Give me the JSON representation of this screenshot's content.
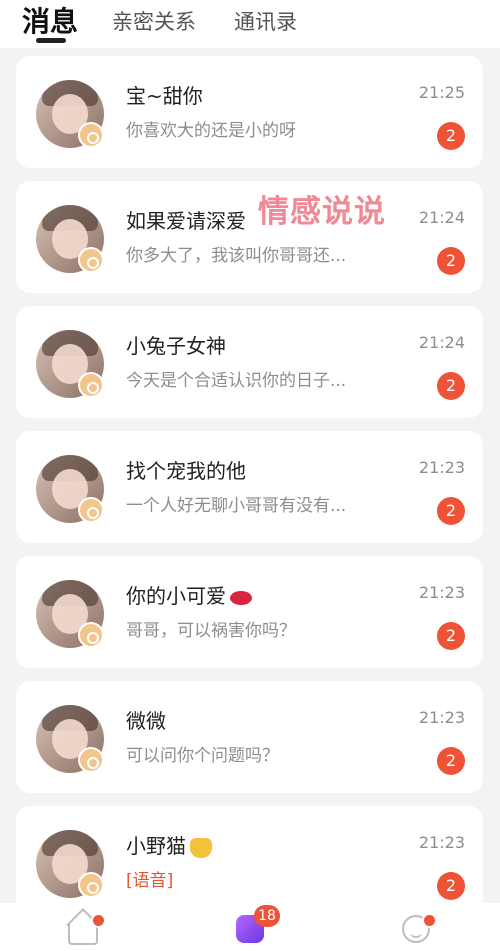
{
  "header": {
    "tabs": [
      {
        "label": "消息"
      },
      {
        "label": "亲密关系"
      },
      {
        "label": "通讯录"
      }
    ]
  },
  "watermark": "情感说说",
  "conversations": [
    {
      "name": "宝~甜你",
      "preview": "你喜欢大的还是小的呀",
      "time": "21:25",
      "unread": "2"
    },
    {
      "name": "如果爱请深爱",
      "preview": "你多大了，我该叫你哥哥还...",
      "time": "21:24",
      "unread": "2"
    },
    {
      "name": "小兔子女神",
      "preview": "今天是个合适认识你的日子...",
      "time": "21:24",
      "unread": "2"
    },
    {
      "name": "找个宠我的他",
      "preview": "一个人好无聊小哥哥有没有...",
      "time": "21:23",
      "unread": "2"
    },
    {
      "name": "你的小可爱",
      "preview": "哥哥，可以祸害你吗？",
      "time": "21:23",
      "unread": "2"
    },
    {
      "name": "微微",
      "preview": "可以问你个问题吗？",
      "time": "21:23",
      "unread": "2"
    },
    {
      "name": "小野猫",
      "preview": "[语音]",
      "time": "21:23",
      "unread": "2"
    }
  ],
  "bottom_nav": {
    "messages_badge": "18"
  },
  "icons": {
    "home": "home-icon",
    "messages": "chat-bubble-icon",
    "profile": "smile-profile-icon"
  },
  "colors": {
    "accent": "#ee5337",
    "nav_active": "#8a4cf0"
  }
}
